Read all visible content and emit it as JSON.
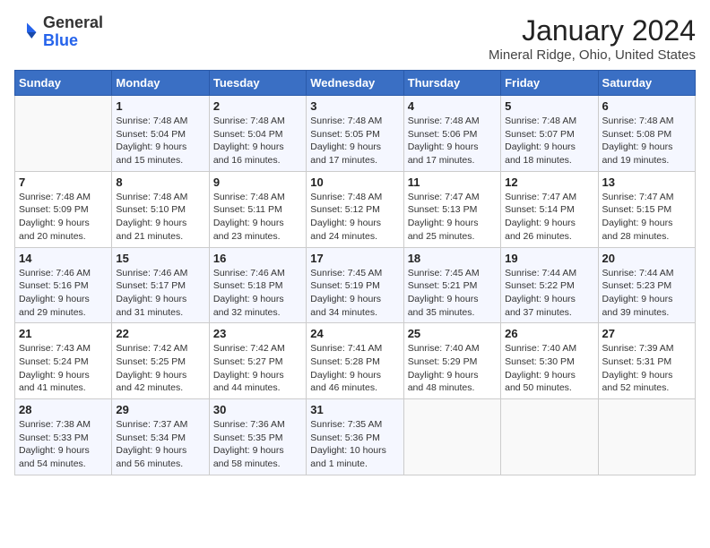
{
  "header": {
    "logo_line1": "General",
    "logo_line2": "Blue",
    "title": "January 2024",
    "subtitle": "Mineral Ridge, Ohio, United States"
  },
  "calendar": {
    "days_of_week": [
      "Sunday",
      "Monday",
      "Tuesday",
      "Wednesday",
      "Thursday",
      "Friday",
      "Saturday"
    ],
    "weeks": [
      [
        {
          "day": "",
          "info": ""
        },
        {
          "day": "1",
          "info": "Sunrise: 7:48 AM\nSunset: 5:04 PM\nDaylight: 9 hours\nand 15 minutes."
        },
        {
          "day": "2",
          "info": "Sunrise: 7:48 AM\nSunset: 5:04 PM\nDaylight: 9 hours\nand 16 minutes."
        },
        {
          "day": "3",
          "info": "Sunrise: 7:48 AM\nSunset: 5:05 PM\nDaylight: 9 hours\nand 17 minutes."
        },
        {
          "day": "4",
          "info": "Sunrise: 7:48 AM\nSunset: 5:06 PM\nDaylight: 9 hours\nand 17 minutes."
        },
        {
          "day": "5",
          "info": "Sunrise: 7:48 AM\nSunset: 5:07 PM\nDaylight: 9 hours\nand 18 minutes."
        },
        {
          "day": "6",
          "info": "Sunrise: 7:48 AM\nSunset: 5:08 PM\nDaylight: 9 hours\nand 19 minutes."
        }
      ],
      [
        {
          "day": "7",
          "info": "Sunrise: 7:48 AM\nSunset: 5:09 PM\nDaylight: 9 hours\nand 20 minutes."
        },
        {
          "day": "8",
          "info": "Sunrise: 7:48 AM\nSunset: 5:10 PM\nDaylight: 9 hours\nand 21 minutes."
        },
        {
          "day": "9",
          "info": "Sunrise: 7:48 AM\nSunset: 5:11 PM\nDaylight: 9 hours\nand 23 minutes."
        },
        {
          "day": "10",
          "info": "Sunrise: 7:48 AM\nSunset: 5:12 PM\nDaylight: 9 hours\nand 24 minutes."
        },
        {
          "day": "11",
          "info": "Sunrise: 7:47 AM\nSunset: 5:13 PM\nDaylight: 9 hours\nand 25 minutes."
        },
        {
          "day": "12",
          "info": "Sunrise: 7:47 AM\nSunset: 5:14 PM\nDaylight: 9 hours\nand 26 minutes."
        },
        {
          "day": "13",
          "info": "Sunrise: 7:47 AM\nSunset: 5:15 PM\nDaylight: 9 hours\nand 28 minutes."
        }
      ],
      [
        {
          "day": "14",
          "info": "Sunrise: 7:46 AM\nSunset: 5:16 PM\nDaylight: 9 hours\nand 29 minutes."
        },
        {
          "day": "15",
          "info": "Sunrise: 7:46 AM\nSunset: 5:17 PM\nDaylight: 9 hours\nand 31 minutes."
        },
        {
          "day": "16",
          "info": "Sunrise: 7:46 AM\nSunset: 5:18 PM\nDaylight: 9 hours\nand 32 minutes."
        },
        {
          "day": "17",
          "info": "Sunrise: 7:45 AM\nSunset: 5:19 PM\nDaylight: 9 hours\nand 34 minutes."
        },
        {
          "day": "18",
          "info": "Sunrise: 7:45 AM\nSunset: 5:21 PM\nDaylight: 9 hours\nand 35 minutes."
        },
        {
          "day": "19",
          "info": "Sunrise: 7:44 AM\nSunset: 5:22 PM\nDaylight: 9 hours\nand 37 minutes."
        },
        {
          "day": "20",
          "info": "Sunrise: 7:44 AM\nSunset: 5:23 PM\nDaylight: 9 hours\nand 39 minutes."
        }
      ],
      [
        {
          "day": "21",
          "info": "Sunrise: 7:43 AM\nSunset: 5:24 PM\nDaylight: 9 hours\nand 41 minutes."
        },
        {
          "day": "22",
          "info": "Sunrise: 7:42 AM\nSunset: 5:25 PM\nDaylight: 9 hours\nand 42 minutes."
        },
        {
          "day": "23",
          "info": "Sunrise: 7:42 AM\nSunset: 5:27 PM\nDaylight: 9 hours\nand 44 minutes."
        },
        {
          "day": "24",
          "info": "Sunrise: 7:41 AM\nSunset: 5:28 PM\nDaylight: 9 hours\nand 46 minutes."
        },
        {
          "day": "25",
          "info": "Sunrise: 7:40 AM\nSunset: 5:29 PM\nDaylight: 9 hours\nand 48 minutes."
        },
        {
          "day": "26",
          "info": "Sunrise: 7:40 AM\nSunset: 5:30 PM\nDaylight: 9 hours\nand 50 minutes."
        },
        {
          "day": "27",
          "info": "Sunrise: 7:39 AM\nSunset: 5:31 PM\nDaylight: 9 hours\nand 52 minutes."
        }
      ],
      [
        {
          "day": "28",
          "info": "Sunrise: 7:38 AM\nSunset: 5:33 PM\nDaylight: 9 hours\nand 54 minutes."
        },
        {
          "day": "29",
          "info": "Sunrise: 7:37 AM\nSunset: 5:34 PM\nDaylight: 9 hours\nand 56 minutes."
        },
        {
          "day": "30",
          "info": "Sunrise: 7:36 AM\nSunset: 5:35 PM\nDaylight: 9 hours\nand 58 minutes."
        },
        {
          "day": "31",
          "info": "Sunrise: 7:35 AM\nSunset: 5:36 PM\nDaylight: 10 hours\nand 1 minute."
        },
        {
          "day": "",
          "info": ""
        },
        {
          "day": "",
          "info": ""
        },
        {
          "day": "",
          "info": ""
        }
      ]
    ]
  }
}
